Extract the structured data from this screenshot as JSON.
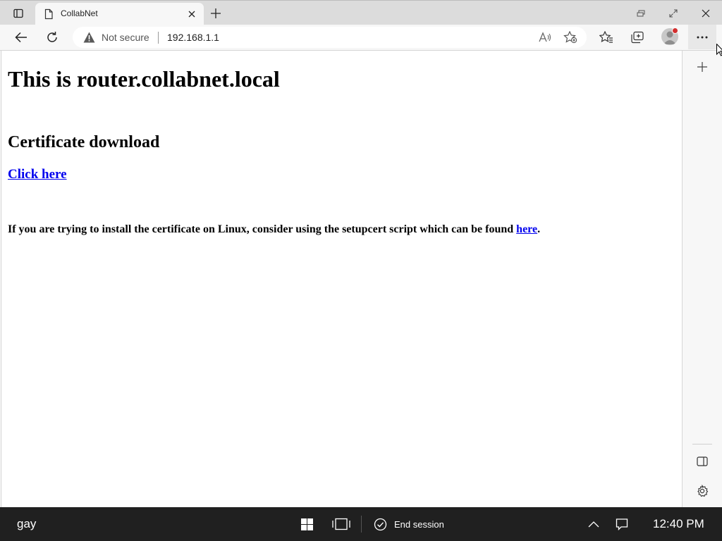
{
  "browser": {
    "tab": {
      "title": "CollabNet"
    },
    "address": {
      "security_label": "Not secure",
      "url": "192.168.1.1"
    }
  },
  "page": {
    "heading": "This is router.collabnet.local",
    "section_title": "Certificate download",
    "download_link": "Click here",
    "linux_text": "If you are trying to install the certificate on Linux, consider using the setupcert script which can be found ",
    "linux_link": "here",
    "linux_text_end": "."
  },
  "taskbar": {
    "user": "gay",
    "end_session": "End session",
    "clock": "12:40 PM"
  },
  "colors": {
    "link": "#0000ee",
    "taskbar": "#202020",
    "notification_dot": "#d32f2f"
  }
}
